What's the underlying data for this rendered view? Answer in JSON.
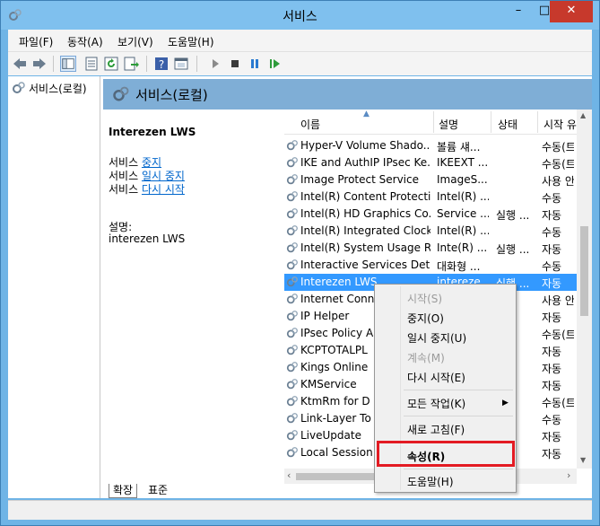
{
  "window": {
    "title": "서비스"
  },
  "menu": [
    "파일(F)",
    "동작(A)",
    "보기(V)",
    "도움말(H)"
  ],
  "tree": {
    "root_label": "서비스(로컬)"
  },
  "panel": {
    "header": "서비스(로컬)"
  },
  "details": {
    "service_name": "Interezen LWS",
    "actions": [
      {
        "prefix": "서비스 ",
        "link": "중지"
      },
      {
        "prefix": "서비스 ",
        "link": "일시 중지"
      },
      {
        "prefix": "서비스 ",
        "link": "다시 시작"
      }
    ],
    "desc_label": "설명:",
    "desc_text": "interezen LWS"
  },
  "columns": {
    "name": "이름",
    "desc": "설명",
    "status": "상태",
    "startup": "시작 유"
  },
  "rows": [
    {
      "name": "Hyper-V Volume Shado...",
      "desc": "볼륨 섀...",
      "status": "",
      "startup": "수동(트"
    },
    {
      "name": "IKE and AuthIP IPsec Ke...",
      "desc": "IKEEXT ...",
      "status": "",
      "startup": "수동(트"
    },
    {
      "name": "Image Protect Service",
      "desc": "ImageS...",
      "status": "",
      "startup": "사용 안"
    },
    {
      "name": "Intel(R) Content Protecti...",
      "desc": "Intel(R) ...",
      "status": "",
      "startup": "수동"
    },
    {
      "name": "Intel(R) HD Graphics Co...",
      "desc": "Service ...",
      "status": "실행 ...",
      "startup": "자동"
    },
    {
      "name": "Intel(R) Integrated Clock...",
      "desc": "Intel(R) ...",
      "status": "",
      "startup": "수동"
    },
    {
      "name": "Intel(R) System Usage R...",
      "desc": "Inte(R) ...",
      "status": "실행 ...",
      "startup": "자동"
    },
    {
      "name": "Interactive Services Det...",
      "desc": "대화형 ...",
      "status": "",
      "startup": "수동"
    },
    {
      "name": "Interezen LWS",
      "desc": "intereze...",
      "status": "실행 ...",
      "startup": "자동"
    },
    {
      "name": "Internet Conn",
      "desc": "",
      "status": "",
      "startup": "사용 안"
    },
    {
      "name": "IP Helper",
      "desc": "",
      "status": "",
      "startup": "자동"
    },
    {
      "name": "IPsec Policy A",
      "desc": "",
      "status": "",
      "startup": "수동(트"
    },
    {
      "name": "KCPTOTALPL",
      "desc": "",
      "status": "",
      "startup": "자동"
    },
    {
      "name": "Kings Online",
      "desc": "",
      "status": "",
      "startup": "자동"
    },
    {
      "name": "KMService",
      "desc": "",
      "status": "",
      "startup": "자동"
    },
    {
      "name": "KtmRm for D",
      "desc": "",
      "status": "",
      "startup": "수동(트"
    },
    {
      "name": "Link-Layer To",
      "desc": "",
      "status": "",
      "startup": "수동"
    },
    {
      "name": "LiveUpdate",
      "desc": "",
      "status": "",
      "startup": "자동"
    },
    {
      "name": "Local Session",
      "desc": "",
      "status": "",
      "startup": "자동"
    }
  ],
  "selected_row": 8,
  "tabs": [
    "확장",
    "표준"
  ],
  "context_menu": {
    "start": "시작(S)",
    "stop": "중지(O)",
    "pause": "일시 중지(U)",
    "resume": "계속(M)",
    "restart": "다시 시작(E)",
    "all_tasks": "모든 작업(K)",
    "refresh": "새로 고침(F)",
    "properties": "속성(R)",
    "help": "도움말(H)"
  },
  "colors": {
    "selection": "#3399ff",
    "highlight_box": "#e31b23",
    "header_bg": "#7faed6"
  }
}
